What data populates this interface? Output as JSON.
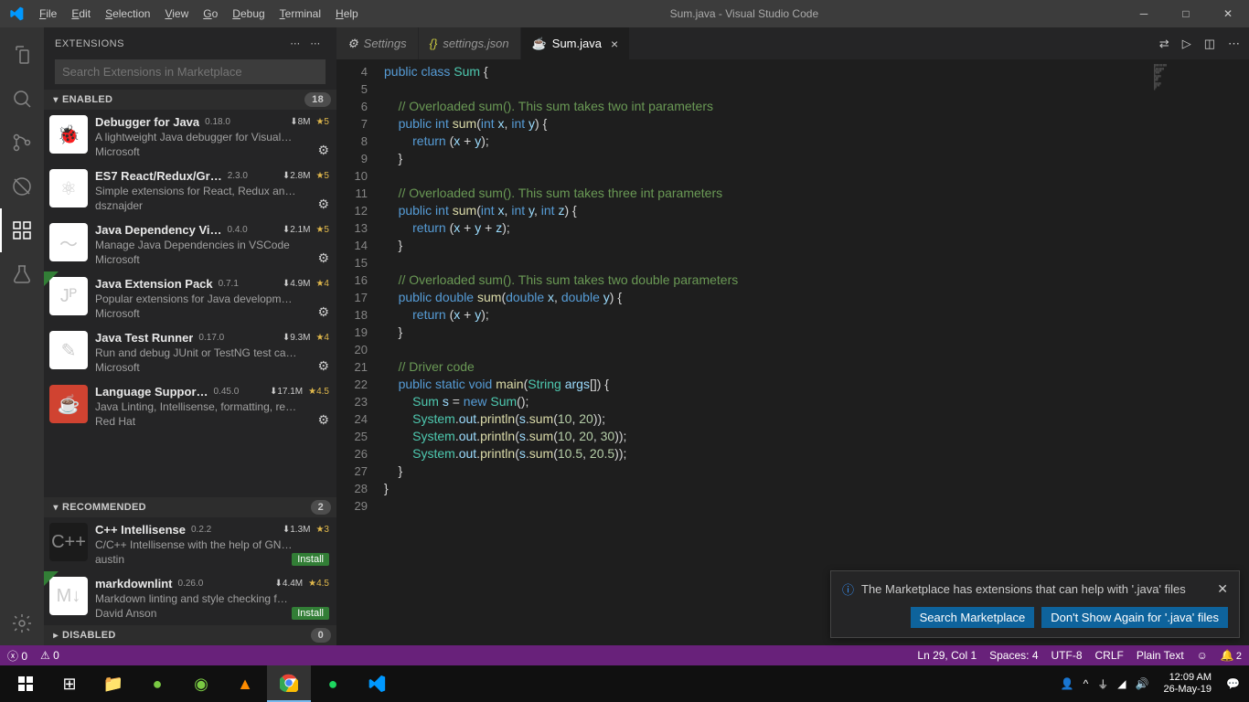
{
  "titlebar": {
    "title": "Sum.java - Visual Studio Code"
  },
  "menus": [
    "File",
    "Edit",
    "Selection",
    "View",
    "Go",
    "Debug",
    "Terminal",
    "Help"
  ],
  "sidebar": {
    "title": "EXTENSIONS",
    "search_placeholder": "Search Extensions in Marketplace",
    "sections": {
      "enabled": {
        "label": "ENABLED",
        "badge": "18"
      },
      "recommended": {
        "label": "RECOMMENDED",
        "badge": "2"
      },
      "disabled": {
        "label": "DISABLED",
        "badge": "0"
      }
    },
    "enabled": [
      {
        "name": "Debugger for Java",
        "ver": "0.18.0",
        "dl": "8M",
        "rating": "5",
        "desc": "A lightweight Java debugger for Visual…",
        "pub": "Microsoft",
        "iconText": "🐞",
        "ribbon": false
      },
      {
        "name": "ES7 React/Redux/Gr…",
        "ver": "2.3.0",
        "dl": "2.8M",
        "rating": "5",
        "desc": "Simple extensions for React, Redux an…",
        "pub": "dsznajder",
        "iconText": "⚛"
      },
      {
        "name": "Java Dependency Vi…",
        "ver": "0.4.0",
        "dl": "2.1M",
        "rating": "5",
        "desc": "Manage Java Dependencies in VSCode",
        "pub": "Microsoft",
        "iconText": "～"
      },
      {
        "name": "Java Extension Pack",
        "ver": "0.7.1",
        "dl": "4.9M",
        "rating": "4",
        "desc": "Popular extensions for Java developm…",
        "pub": "Microsoft",
        "iconText": "Jᴾ",
        "ribbon": true
      },
      {
        "name": "Java Test Runner",
        "ver": "0.17.0",
        "dl": "9.3M",
        "rating": "4",
        "desc": "Run and debug JUnit or TestNG test ca…",
        "pub": "Microsoft",
        "iconText": "✎"
      },
      {
        "name": "Language Suppor…",
        "ver": "0.45.0",
        "dl": "17.1M",
        "rating": "4.5",
        "desc": "Java Linting, Intellisense, formatting, re…",
        "pub": "Red Hat",
        "iconText": "☕",
        "iconRed": true
      }
    ],
    "recommended": [
      {
        "name": "C++ Intellisense",
        "ver": "0.2.2",
        "dl": "1.3M",
        "rating": "3",
        "desc": "C/C++ Intellisense with the help of GN…",
        "pub": "austin",
        "iconText": "C++",
        "iconDark": true,
        "install": "Install"
      },
      {
        "name": "markdownlint",
        "ver": "0.26.0",
        "dl": "4.4M",
        "rating": "4.5",
        "desc": "Markdown linting and style checking f…",
        "pub": "David Anson",
        "iconText": "M↓",
        "install": "Install",
        "ribbon": true
      }
    ]
  },
  "tabs": [
    {
      "icon": "gear",
      "label": "Settings",
      "active": false
    },
    {
      "icon": "json",
      "label": "settings.json",
      "active": false
    },
    {
      "icon": "java",
      "label": "Sum.java",
      "active": true,
      "closable": true
    }
  ],
  "code": {
    "start": 4,
    "lines": [
      {
        "n": 4,
        "t": "<span class='kw'>public</span> <span class='kw'>class</span> <span class='cls'>Sum</span> {"
      },
      {
        "n": 5,
        "t": ""
      },
      {
        "n": 6,
        "t": "    <span class='cm'>// Overloaded sum(). This sum takes two int parameters</span>"
      },
      {
        "n": 7,
        "t": "    <span class='kw'>public</span> <span class='kw'>int</span> <span class='fn'>sum</span>(<span class='kw'>int</span> <span class='vr'>x</span>, <span class='kw'>int</span> <span class='vr'>y</span>) {"
      },
      {
        "n": 8,
        "t": "        <span class='kw'>return</span> (<span class='vr'>x</span> + <span class='vr'>y</span>);"
      },
      {
        "n": 9,
        "t": "    }"
      },
      {
        "n": 10,
        "t": ""
      },
      {
        "n": 11,
        "t": "    <span class='cm'>// Overloaded sum(). This sum takes three int parameters</span>"
      },
      {
        "n": 12,
        "t": "    <span class='kw'>public</span> <span class='kw'>int</span> <span class='fn'>sum</span>(<span class='kw'>int</span> <span class='vr'>x</span>, <span class='kw'>int</span> <span class='vr'>y</span>, <span class='kw'>int</span> <span class='vr'>z</span>) {"
      },
      {
        "n": 13,
        "t": "        <span class='kw'>return</span> (<span class='vr'>x</span> + <span class='vr'>y</span> + <span class='vr'>z</span>);"
      },
      {
        "n": 14,
        "t": "    }"
      },
      {
        "n": 15,
        "t": ""
      },
      {
        "n": 16,
        "t": "    <span class='cm'>// Overloaded sum(). This sum takes two double parameters</span>"
      },
      {
        "n": 17,
        "t": "    <span class='kw'>public</span> <span class='kw'>double</span> <span class='fn'>sum</span>(<span class='kw'>double</span> <span class='vr'>x</span>, <span class='kw'>double</span> <span class='vr'>y</span>) {"
      },
      {
        "n": 18,
        "t": "        <span class='kw'>return</span> (<span class='vr'>x</span> + <span class='vr'>y</span>);"
      },
      {
        "n": 19,
        "t": "    }"
      },
      {
        "n": 20,
        "t": ""
      },
      {
        "n": 21,
        "t": "    <span class='cm'>// Driver code</span>"
      },
      {
        "n": 22,
        "t": "    <span class='kw'>public</span> <span class='kw'>static</span> <span class='kw'>void</span> <span class='fn'>main</span>(<span class='cls'>String</span> <span class='vr'>args</span>[]) {"
      },
      {
        "n": 23,
        "t": "        <span class='cls'>Sum</span> <span class='vr'>s</span> = <span class='kw'>new</span> <span class='cls'>Sum</span>();"
      },
      {
        "n": 24,
        "t": "        <span class='cls'>System</span>.<span class='vr'>out</span>.<span class='fn'>println</span>(<span class='vr'>s</span>.<span class='fn'>sum</span>(<span class='nm'>10</span>, <span class='nm'>20</span>));"
      },
      {
        "n": 25,
        "t": "        <span class='cls'>System</span>.<span class='vr'>out</span>.<span class='fn'>println</span>(<span class='vr'>s</span>.<span class='fn'>sum</span>(<span class='nm'>10</span>, <span class='nm'>20</span>, <span class='nm'>30</span>));"
      },
      {
        "n": 26,
        "t": "        <span class='cls'>System</span>.<span class='vr'>out</span>.<span class='fn'>println</span>(<span class='vr'>s</span>.<span class='fn'>sum</span>(<span class='nm'>10.5</span>, <span class='nm'>20.5</span>));"
      },
      {
        "n": 27,
        "t": "    }"
      },
      {
        "n": 28,
        "t": "}"
      },
      {
        "n": 29,
        "t": ""
      }
    ]
  },
  "notification": {
    "text": "The Marketplace has extensions that can help with '.java' files",
    "buttons": [
      "Search Marketplace",
      "Don't Show Again for '.java' files"
    ]
  },
  "status": {
    "errors": "0",
    "warnings": "0",
    "ln": "Ln 29, Col 1",
    "spaces": "Spaces: 4",
    "enc": "UTF-8",
    "eol": "CRLF",
    "lang": "Plain Text",
    "bell": "2"
  },
  "tray": {
    "time": "12:09 AM",
    "date": "26-May-19"
  }
}
